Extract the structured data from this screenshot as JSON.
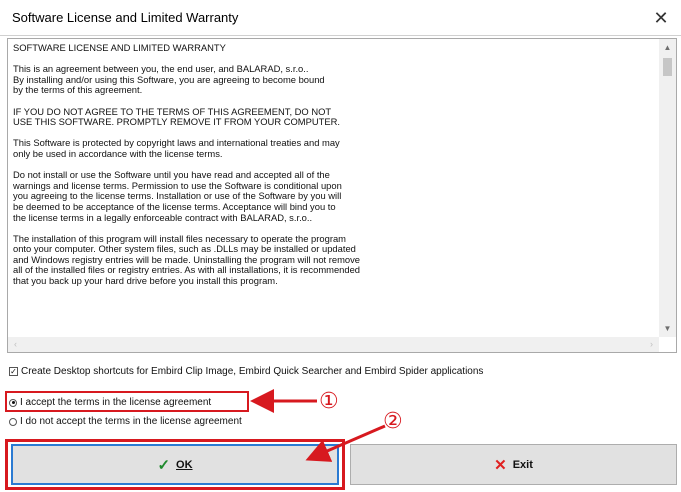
{
  "window": {
    "title": "Software License and Limited Warranty",
    "close_glyph": "✕"
  },
  "license": {
    "paragraphs": [
      "SOFTWARE LICENSE AND LIMITED WARRANTY",
      "This is an agreement between you, the end user, and BALARAD, s.r.o..\nBy installing and/or using this Software, you are agreeing to become bound\nby the terms of this agreement.",
      "IF YOU DO NOT AGREE TO THE TERMS OF THIS AGREEMENT, DO NOT\nUSE THIS SOFTWARE. PROMPTLY REMOVE IT FROM YOUR COMPUTER.",
      "This Software is protected by copyright laws and international treaties and may\nonly be used in accordance with the license terms.",
      "Do not install or use the Software until you have read and accepted all of the\nwarnings and license terms.  Permission to use the Software is conditional upon\nyou agreeing to the license terms. Installation or use of the Software by you will\nbe deemed to be acceptance of the license terms.  Acceptance will bind you to\nthe license terms in a legally enforceable contract with BALARAD, s.r.o..",
      "The installation of this program will install files necessary to operate the program\nonto your computer. Other system files, such as .DLLs may be installed or updated\nand Windows registry entries will be made. Uninstalling the program will not remove\nall of the installed files or registry entries. As with all installations, it is recommended\nthat you back up your hard drive before you install this program."
    ]
  },
  "options": {
    "shortcuts_label": "Create Desktop shortcuts for Embird Clip Image, Embird Quick Searcher and Embird Spider applications",
    "shortcuts_checked": true,
    "accept_label": "I accept the terms in the license agreement",
    "decline_label": "I do not accept the terms in the license agreement",
    "selected": "accept"
  },
  "buttons": {
    "ok_label": "OK",
    "exit_label": "Exit"
  },
  "annotations": {
    "callout_1": "①",
    "callout_2": "②",
    "color": "#d7191f"
  },
  "icons": {
    "ok": "check-icon",
    "exit": "x-icon"
  }
}
